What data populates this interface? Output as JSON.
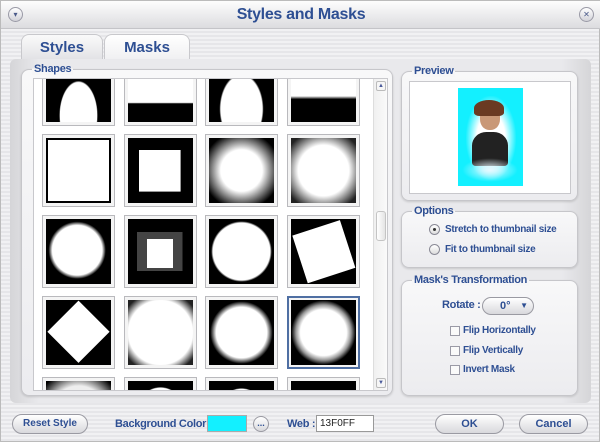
{
  "window": {
    "title": "Styles and Masks",
    "menu_icon": "chevron-down-icon",
    "close_icon": "close-icon"
  },
  "tabs": [
    {
      "label": "Styles",
      "active": false
    },
    {
      "label": "Masks",
      "active": true
    }
  ],
  "shapes": {
    "label": "Shapes",
    "selected_index": 15,
    "count_visible": 20
  },
  "preview": {
    "label": "Preview",
    "background_color": "#13F0FF"
  },
  "options": {
    "label": "Options",
    "items": [
      {
        "label": "Stretch to thumbnail size",
        "selected": true
      },
      {
        "label": "Fit to thumbnail size",
        "selected": false
      }
    ]
  },
  "transformation": {
    "label": "Mask's Transformation",
    "rotate_label": "Rotate :",
    "rotate_value": "0°",
    "flip_h": {
      "label": "Flip Horizontally",
      "checked": false
    },
    "flip_v": {
      "label": "Flip Vertically",
      "checked": false
    },
    "invert": {
      "label": "Invert Mask",
      "checked": false
    }
  },
  "footer": {
    "reset_label": "Reset Style",
    "bg_color_label": "Background Color :",
    "bg_color": "#13F0FF",
    "more_label": "...",
    "web_label": "Web :",
    "web_value": "13F0FF",
    "ok_label": "OK",
    "cancel_label": "Cancel"
  },
  "colors": {
    "accent": "#2E4F93",
    "selection": "#4F6FA3"
  }
}
